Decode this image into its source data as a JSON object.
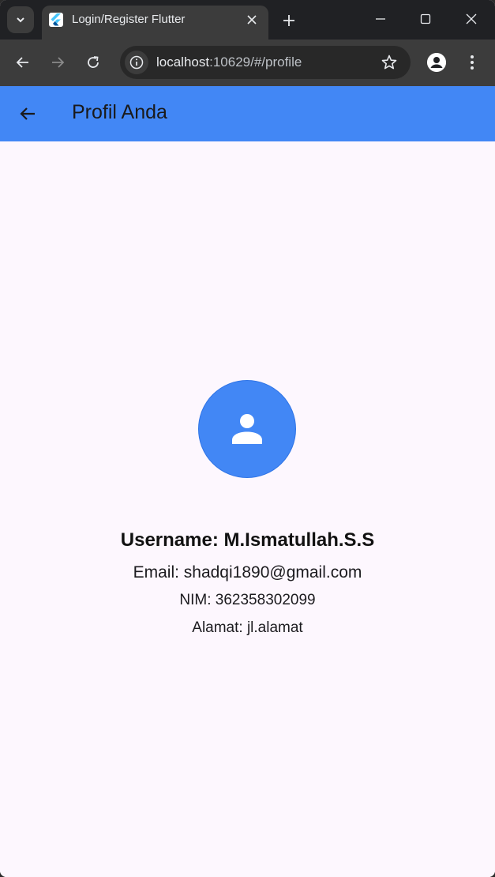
{
  "browser": {
    "tab_title": "Login/Register Flutter",
    "url_host": "localhost",
    "url_path": ":10629/#/profile"
  },
  "appbar": {
    "title": "Profil Anda"
  },
  "profile": {
    "username": "Username: M.Ismatullah.S.S",
    "email": "Email: shadqi1890@gmail.com",
    "nim": "NIM: 362358302099",
    "alamat": "Alamat: jl.alamat"
  },
  "colors": {
    "accent": "#4287f5",
    "background": "#fdf7fe",
    "chrome_dark": "#202124",
    "chrome_toolbar": "#3c3c3c"
  },
  "icons": [
    "tab-search-icon",
    "flutter-logo-icon",
    "close-icon",
    "plus-icon",
    "minimize-icon",
    "maximize-icon",
    "window-close-icon",
    "back-arrow-icon",
    "forward-arrow-icon",
    "reload-icon",
    "info-icon",
    "star-icon",
    "profile-icon",
    "kebab-menu-icon",
    "appbar-back-icon",
    "person-icon"
  ]
}
